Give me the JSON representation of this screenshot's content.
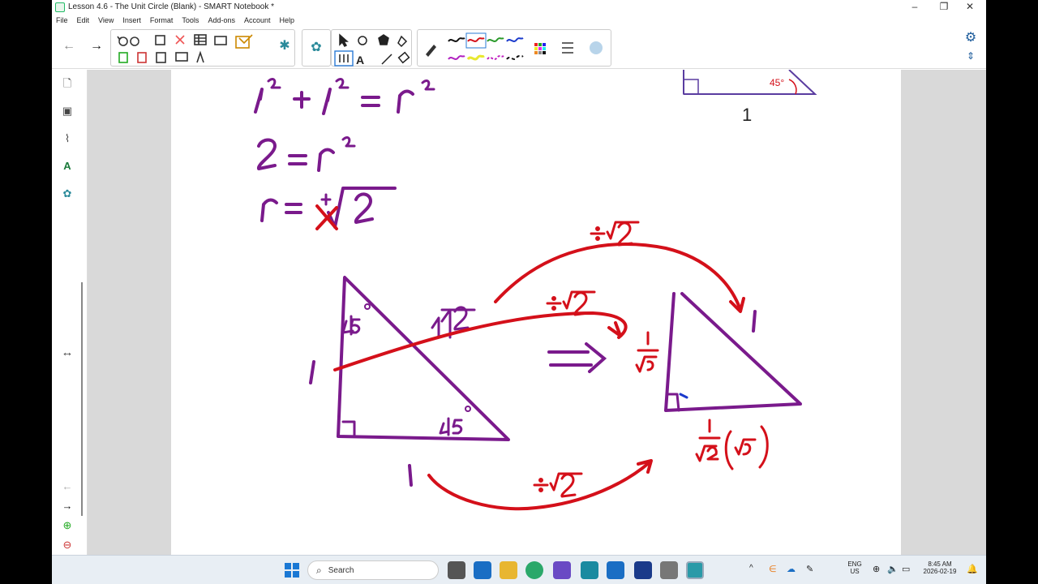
{
  "window": {
    "title": "Lesson 4.6 - The Unit Circle (Blank) - SMART Notebook *",
    "minimize_glyph": "–",
    "restore_glyph": "❐",
    "close_glyph": "✕"
  },
  "menu": [
    "File",
    "Edit",
    "View",
    "Insert",
    "Format",
    "Tools",
    "Add-ons",
    "Account",
    "Help"
  ],
  "toolbar": {
    "back_glyph": "←",
    "forward_glyph": "→",
    "text_tool_glyph": "A"
  },
  "sidebar": {
    "resize_glyph": "↔",
    "nav_back_glyph": "←",
    "nav_forward_glyph": "→"
  },
  "page": {
    "reference_triangle_angle": "45°",
    "reference_triangle_side": "1"
  },
  "taskbar": {
    "search_label": "Search",
    "language_line1": "ENG",
    "language_line2": "US",
    "time": "8:45 AM",
    "date": "2026-02-19",
    "chevron_glyph": "^"
  },
  "colors": {
    "ink_purple": "#7a1a8c",
    "ink_red": "#d4101a",
    "active_pen_highlight": "#2a7bd6"
  }
}
